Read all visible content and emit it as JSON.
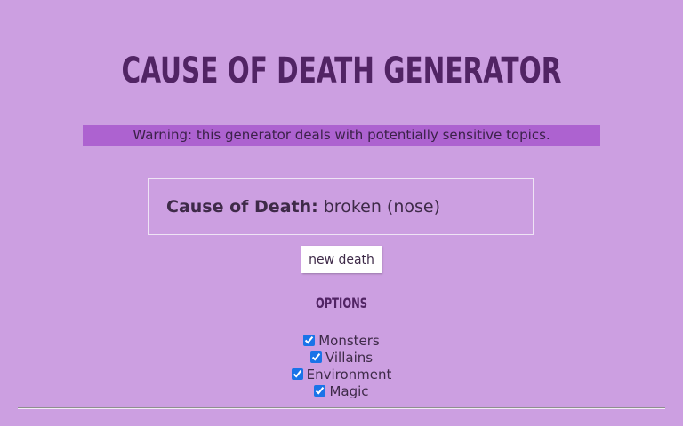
{
  "header": {
    "title": "Cause of Death Generator"
  },
  "warning": {
    "text": "Warning: this generator deals with potentially sensitive topics."
  },
  "result": {
    "label": "Cause of Death:",
    "value": "broken (nose)"
  },
  "actions": {
    "new_death_label": "new death"
  },
  "options": {
    "heading": "Options",
    "items": [
      {
        "label": "Monsters",
        "checked": true
      },
      {
        "label": "Villains",
        "checked": true
      },
      {
        "label": "Environment",
        "checked": true
      },
      {
        "label": "Magic",
        "checked": true
      }
    ]
  },
  "colors": {
    "background": "#cc9fe1",
    "title": "#512464",
    "warning_bar": "#ad62d0",
    "text": "#3e2a48"
  }
}
